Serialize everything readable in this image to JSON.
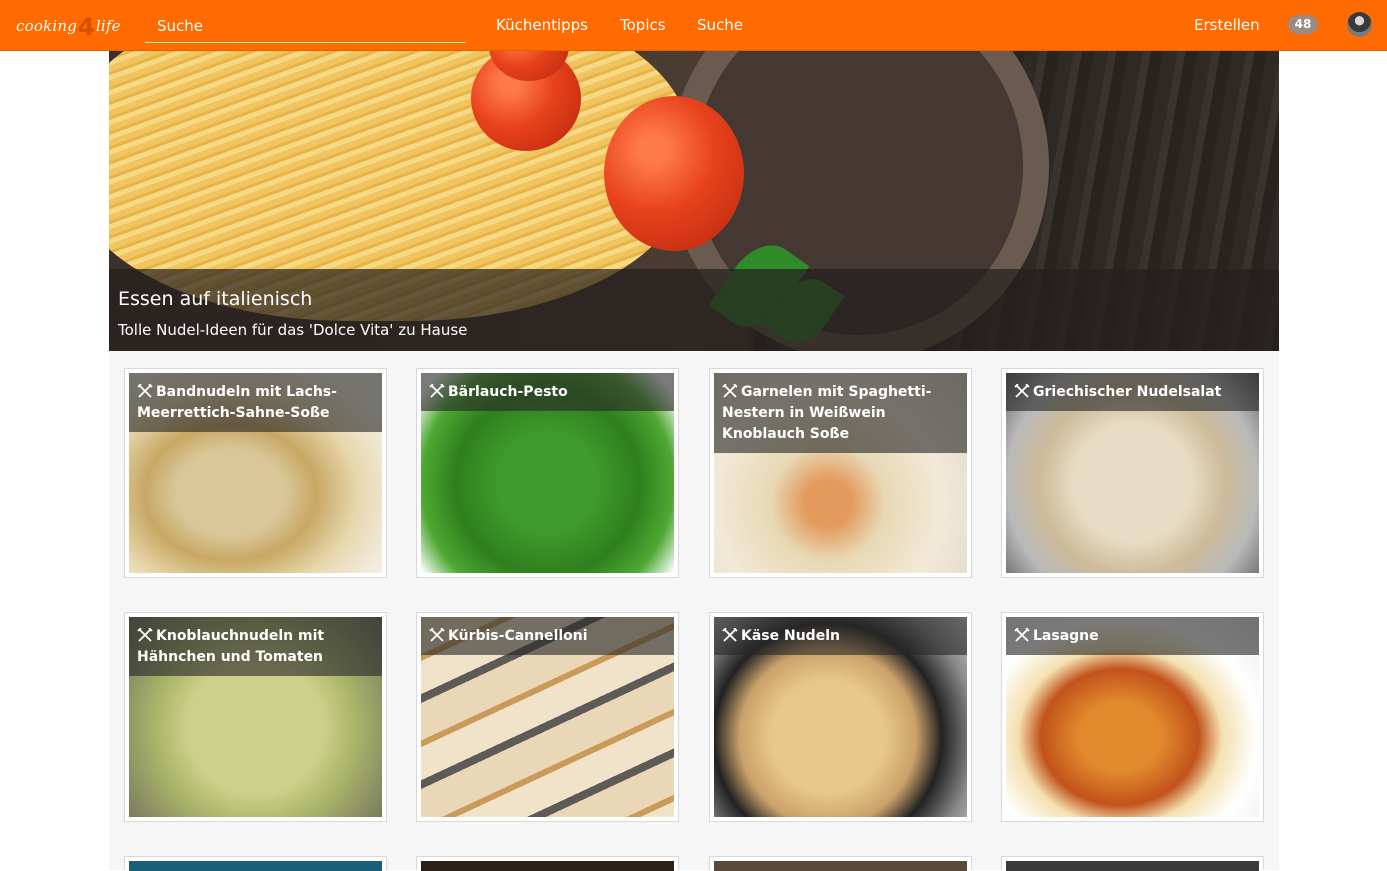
{
  "header": {
    "logo_text_left": "cooking",
    "logo_text_num": "4",
    "logo_text_right": "life",
    "search_placeholder": "Suche",
    "nav": [
      "Küchentipps",
      "Topics",
      "Suche"
    ],
    "create_label": "Erstellen",
    "notification_count": "48"
  },
  "hero": {
    "title": "Essen auf italienisch",
    "subtitle": "Tolle Nudel-Ideen für das 'Dolce Vita' zu Hause"
  },
  "recipes": [
    {
      "title": "Bandnudeln mit Lachs-Meerrettich-Sahne-Soße"
    },
    {
      "title": "Bärlauch-Pesto"
    },
    {
      "title": "Garnelen mit Spaghetti-Nestern in Weißwein Knoblauch Soße"
    },
    {
      "title": "Griechischer Nudelsalat"
    },
    {
      "title": "Knoblauchnudeln mit Hähnchen und Tomaten"
    },
    {
      "title": "Kürbis-Cannelloni"
    },
    {
      "title": "Käse Nudeln"
    },
    {
      "title": "Lasagne"
    }
  ],
  "colors": {
    "brand": "#ff6b00",
    "badge": "#9b8b80",
    "overlay": "rgba(40,40,40,0.62)"
  },
  "icons": {
    "recipe": "fork-knife-icon",
    "avatar": "user-avatar"
  }
}
